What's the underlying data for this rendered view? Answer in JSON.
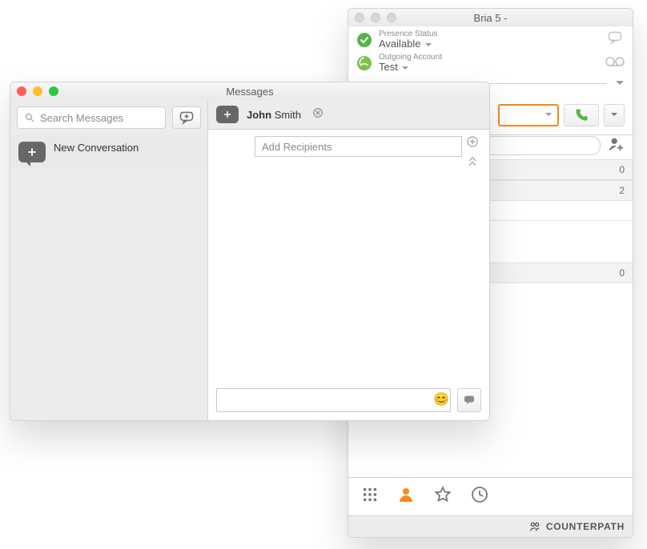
{
  "main_window": {
    "title": "Bria 5 -",
    "presence": {
      "label": "Presence Status",
      "value": "Available"
    },
    "outgoing": {
      "label": "Outgoing Account",
      "value": "Test"
    },
    "rows": {
      "a": "0",
      "b": "2",
      "c": "0"
    },
    "brand": "COUNTERPATH"
  },
  "messages_window": {
    "title": "Messages",
    "search_placeholder": "Search Messages",
    "conversation_title": "New Conversation",
    "contact_first": "John",
    "contact_last": "Smith",
    "recipients_placeholder": "Add Recipients"
  }
}
